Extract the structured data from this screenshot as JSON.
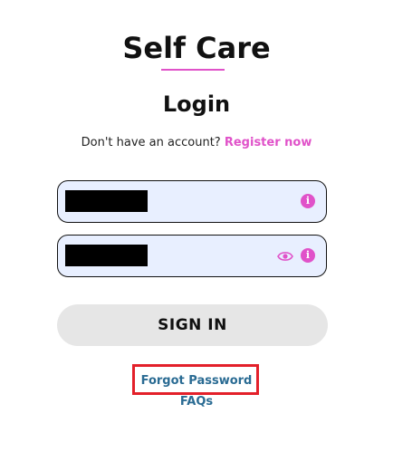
{
  "app": {
    "title": "Self Care"
  },
  "login": {
    "heading": "Login",
    "register_prompt": "Don't have an account?",
    "register_link": "Register now",
    "username_field": {
      "value": "",
      "placeholder": "",
      "redacted": true
    },
    "password_field": {
      "value": "",
      "placeholder": "",
      "redacted": true
    },
    "sign_in_label": "SIGN IN",
    "forgot_password_label": "Forgot Password",
    "faqs_label": "FAQs"
  },
  "icons": {
    "info": "info-icon",
    "eye": "eye-icon"
  },
  "colors": {
    "accent": "#e052c9",
    "field_background": "#e8efff",
    "button_background": "#e6e6e6",
    "link": "#2a6b93",
    "highlight_box": "#e3202a"
  }
}
